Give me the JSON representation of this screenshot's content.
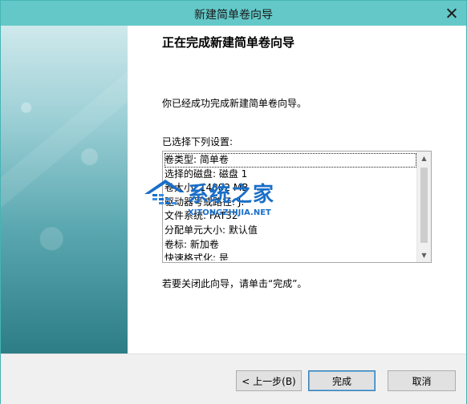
{
  "window": {
    "title": "新建简单卷向导"
  },
  "content": {
    "heading": "正在完成新建简单卷向导",
    "done_text": "你已经成功完成新建简单卷向导。",
    "settings_label": "已选择下列设置:",
    "settings": [
      "卷类型: 简单卷",
      "选择的磁盘: 磁盘 1",
      "卷大小: 14882 MB",
      "驱动器号或路径: J:",
      "文件系统: FAT32",
      "分配单元大小: 默认值",
      "卷标: 新加卷",
      "快速格式化: 是"
    ],
    "close_hint": "若要关闭此向导，请单击“完成”。"
  },
  "watermark": {
    "title": "系统之家",
    "subtitle": "XITONGZHIJIA.NET"
  },
  "buttons": {
    "back": "< 上一步(B)",
    "finish": "完成",
    "cancel": "取消"
  },
  "colors": {
    "titlebar": "#64c8c8",
    "accent": "#3c7fb1",
    "watermark": "#1a6fc8"
  }
}
